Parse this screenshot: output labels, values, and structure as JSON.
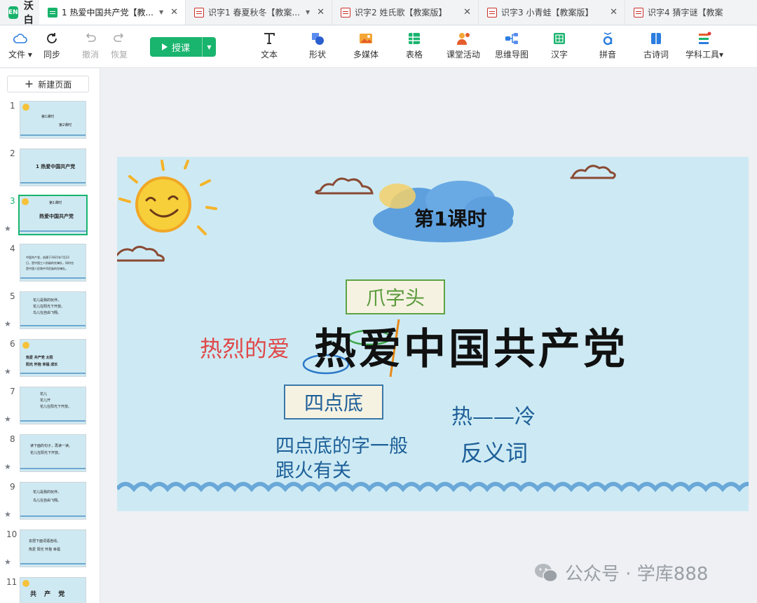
{
  "app": {
    "name": "希沃白板",
    "logo_text": "EN"
  },
  "tabs": [
    {
      "title": "1 热爱中国共产党【教...",
      "active": true
    },
    {
      "title": "识字1 春夏秋冬【教案...",
      "active": false
    },
    {
      "title": "识字2 姓氏歌【教案版】",
      "active": false
    },
    {
      "title": "识字3 小青蛙【教案版】",
      "active": false
    },
    {
      "title": "识字4 猜字谜【教案",
      "active": false
    }
  ],
  "toolbar": {
    "file": "文件",
    "sync": "同步",
    "undo": "撤消",
    "redo": "恢复",
    "teach": "授课",
    "tools": [
      {
        "label": "文本",
        "icon": "text-icon"
      },
      {
        "label": "形状",
        "icon": "shape-icon"
      },
      {
        "label": "多媒体",
        "icon": "media-icon"
      },
      {
        "label": "表格",
        "icon": "table-icon"
      },
      {
        "label": "课堂活动",
        "icon": "activity-icon"
      },
      {
        "label": "思维导图",
        "icon": "mindmap-icon"
      },
      {
        "label": "汉字",
        "icon": "hanzi-icon"
      },
      {
        "label": "拼音",
        "icon": "pinyin-icon"
      },
      {
        "label": "古诗词",
        "icon": "poetry-icon"
      },
      {
        "label": "学科工具",
        "icon": "subject-tools-icon"
      }
    ],
    "colors": {
      "accent": "#19b46e",
      "cloud_blue": "#2b7de0"
    }
  },
  "sidebar": {
    "new_page": "新建页面",
    "thumbs": [
      {
        "num": "1",
        "starred": false,
        "lines": [
          "第1课时",
          "第2课时"
        ]
      },
      {
        "num": "2",
        "starred": false,
        "lines": [
          "1 热爱中国共产党"
        ]
      },
      {
        "num": "3",
        "starred": true,
        "lines": [
          "第1课时",
          "热爱中国共产党"
        ]
      },
      {
        "num": "4",
        "starred": false,
        "lines": [
          "中国共产党，创建于1921年7月23",
          "日，是中国工人阶级的先锋队，同时也",
          "是中国人民和中华民族的先锋队。"
        ]
      },
      {
        "num": "5",
        "starred": true,
        "lines": [
          "花儿是我的玩伴。",
          "花儿在阳光下开放。",
          "鸟儿在自由飞翔。"
        ]
      },
      {
        "num": "6",
        "starred": true,
        "lines": [
          "热爱  共产党  太阳",
          "阳光  怀抱  幸福  成长"
        ]
      },
      {
        "num": "7",
        "starred": true,
        "lines": [
          "花儿",
          "花儿开",
          "花儿在阳光下开放。"
        ]
      },
      {
        "num": "8",
        "starred": true,
        "lines": [
          "读下面的句子，再读一读。",
          "花儿在阳光下开放。"
        ]
      },
      {
        "num": "9",
        "starred": true,
        "lines": [
          "花儿是我的玩伴。",
          "鸟儿在自由飞翔。"
        ]
      },
      {
        "num": "10",
        "starred": true,
        "lines": [
          "去把下面词语连线。",
          "热爱  阳光  怀抱  幸福"
        ]
      },
      {
        "num": "11",
        "starred": false,
        "lines": [
          "共  产  党"
        ]
      }
    ]
  },
  "slide": {
    "lesson_label": "第1课时",
    "top_radical": "爪字头",
    "meaning": "热烈的爱",
    "main_text": "热爱中国共产党",
    "bottom_radical": "四点底",
    "note": "四点底的字一般跟火有关",
    "antonym_pair": "热——冷",
    "antonym_label": "反义词"
  },
  "watermark": {
    "text": "公众号 · 学库888"
  }
}
